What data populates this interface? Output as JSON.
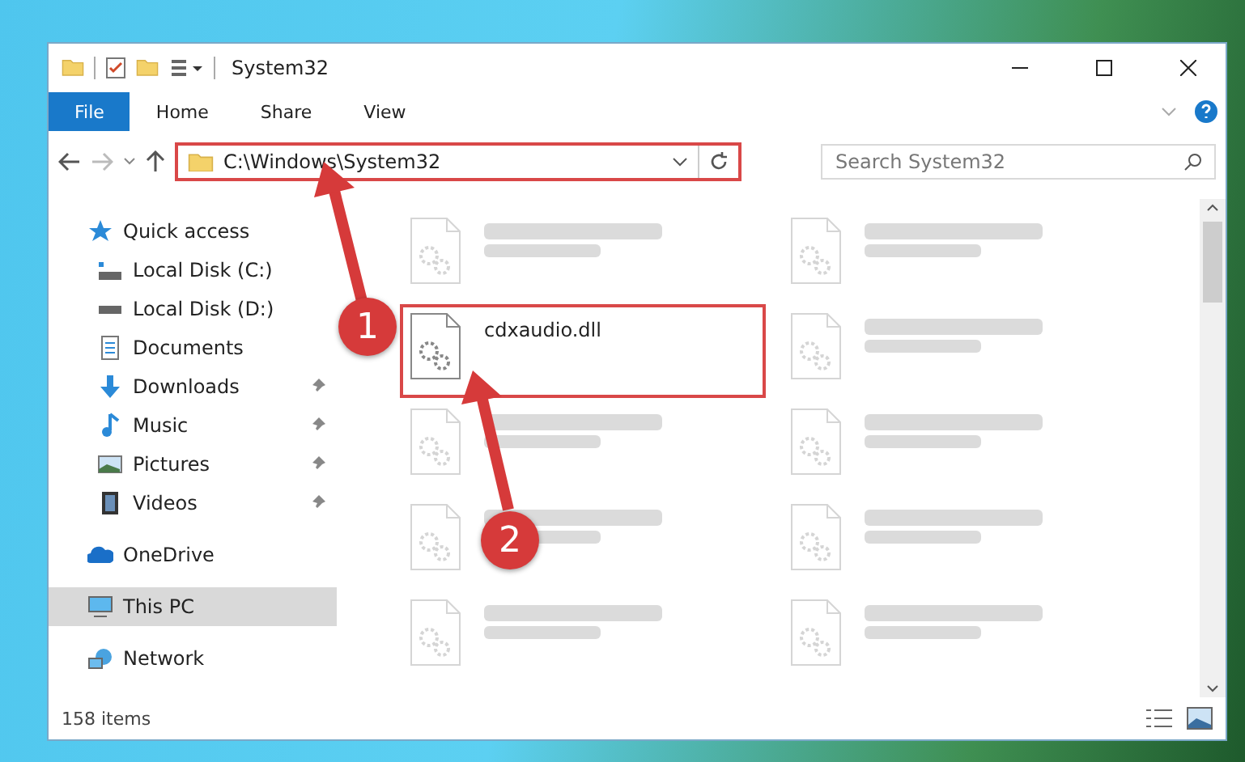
{
  "window": {
    "title": "System32"
  },
  "ribbon_tabs": [
    {
      "label": "File",
      "selected": true
    },
    {
      "label": "Home",
      "selected": false
    },
    {
      "label": "Share",
      "selected": false
    },
    {
      "label": "View",
      "selected": false
    }
  ],
  "address": {
    "path": "C:\\Windows\\System32",
    "highlighted": true
  },
  "search": {
    "placeholder": "Search System32"
  },
  "sidebar": {
    "items": [
      {
        "label": "Quick access",
        "kind": "star",
        "selected": false,
        "children": [
          {
            "label": "Local Disk (C:)",
            "kind": "system-drive",
            "pinned": false,
            "selected": false
          },
          {
            "label": "Local Disk (D:)",
            "kind": "drive",
            "pinned": false,
            "selected": false
          },
          {
            "label": "Documents",
            "kind": "document",
            "pinned": false,
            "selected": false
          },
          {
            "label": "Downloads",
            "kind": "download",
            "pinned": true,
            "selected": false
          },
          {
            "label": "Music",
            "kind": "music",
            "pinned": true,
            "selected": false
          },
          {
            "label": "Pictures",
            "kind": "picture",
            "pinned": true,
            "selected": false
          },
          {
            "label": "Videos",
            "kind": "video",
            "pinned": true,
            "selected": false
          }
        ]
      },
      {
        "label": "OneDrive",
        "kind": "cloud",
        "selected": false
      },
      {
        "label": "This PC",
        "kind": "computer",
        "selected": true
      },
      {
        "label": "Network",
        "kind": "network",
        "selected": false
      }
    ]
  },
  "files": [
    {
      "blurred": true
    },
    {
      "blurred": true
    },
    {
      "name": "cdxaudio.dll",
      "blurred": false,
      "highlighted": true
    },
    {
      "blurred": true
    },
    {
      "blurred": true
    },
    {
      "blurred": true
    },
    {
      "blurred": true
    },
    {
      "blurred": true
    },
    {
      "blurred": true
    },
    {
      "blurred": true
    }
  ],
  "status_bar": {
    "count": "158 items"
  },
  "callouts": [
    {
      "number": "1"
    },
    {
      "number": "2"
    }
  ]
}
